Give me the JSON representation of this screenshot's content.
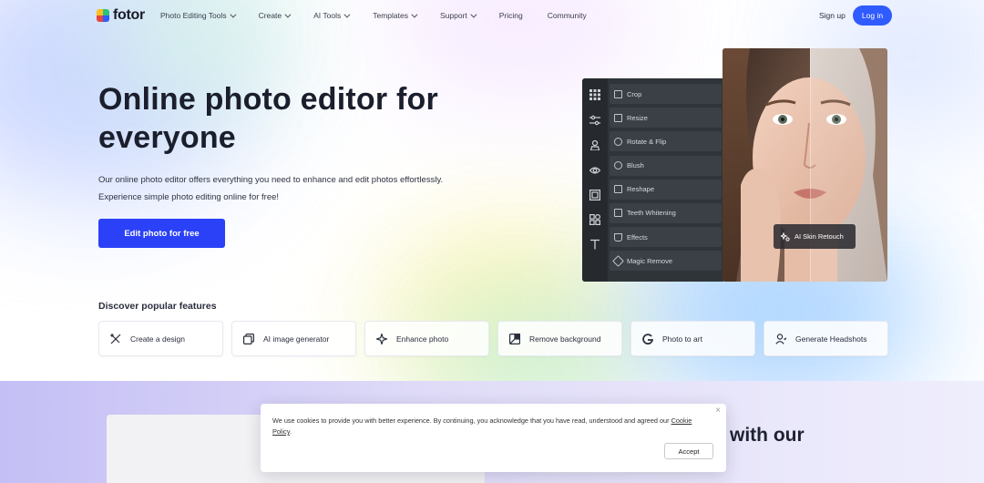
{
  "brand": {
    "name": "fotor",
    "colors": [
      "#f9c020",
      "#2ec27e",
      "#2f5bff",
      "#e8453c"
    ]
  },
  "nav": {
    "items": [
      {
        "label": "Photo Editing Tools",
        "dropdown": true
      },
      {
        "label": "Create",
        "dropdown": true
      },
      {
        "label": "AI Tools",
        "dropdown": true
      },
      {
        "label": "Templates",
        "dropdown": true
      },
      {
        "label": "Support",
        "dropdown": true
      },
      {
        "label": "Pricing",
        "dropdown": false
      },
      {
        "label": "Community",
        "dropdown": false
      }
    ],
    "signup": "Sign up",
    "login": "Log in"
  },
  "hero": {
    "title": "Online photo editor for everyone",
    "description_line1": "Our online photo editor offers everything you need to enhance and edit photos effortlessly.",
    "description_line2": "Experience simple photo editing online for free!",
    "cta": "Edit photo for free"
  },
  "editor": {
    "rail_icons": [
      "grid-icon",
      "sliders-icon",
      "person-icon",
      "eye-icon",
      "frame-icon",
      "elements-icon",
      "text-icon"
    ],
    "tools": [
      {
        "label": "Crop",
        "icon": "crop-icon"
      },
      {
        "label": "Resize",
        "icon": "resize-icon"
      },
      {
        "label": "Rotate & Flip",
        "icon": "rotate-icon"
      },
      {
        "label": "Blush",
        "icon": "blush-icon"
      },
      {
        "label": "Reshape",
        "icon": "reshape-icon"
      },
      {
        "label": "Teeth Whitening",
        "icon": "teeth-icon"
      },
      {
        "label": "Effects",
        "icon": "effects-icon"
      },
      {
        "label": "Magic Remove",
        "icon": "eraser-icon"
      }
    ],
    "retouch_badge": "AI Skin Retouch"
  },
  "features": {
    "title": "Discover popular features",
    "items": [
      {
        "label": "Create a design",
        "icon": "design-icon"
      },
      {
        "label": "AI image generator",
        "icon": "image-generator-icon"
      },
      {
        "label": "Enhance photo",
        "icon": "enhance-icon"
      },
      {
        "label": "Remove background",
        "icon": "remove-bg-icon"
      },
      {
        "label": "Photo to art",
        "icon": "photo-to-art-icon"
      },
      {
        "label": "Generate Headshots",
        "icon": "headshot-icon"
      }
    ]
  },
  "lower": {
    "heading_fragment": "with our"
  },
  "cookie": {
    "text": "We use cookies to provide you with better experience. By continuing, you acknowledge that you have read, understood and agreed our",
    "link": "Cookie Policy",
    "suffix": ".",
    "close": "×",
    "accept": "Accept"
  }
}
